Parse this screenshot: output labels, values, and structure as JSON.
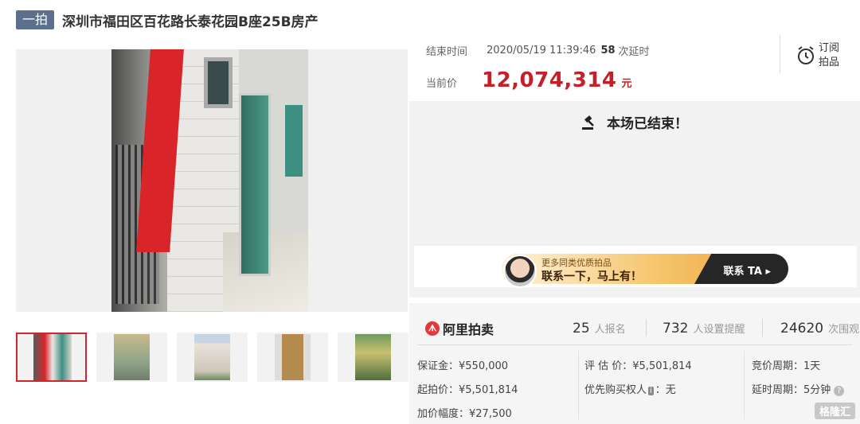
{
  "header": {
    "badge": "一拍",
    "title": "深圳市福田区百花路长泰花园B座25B房产"
  },
  "auction": {
    "end_label": "结束时间",
    "end_time": "2020/05/19 11:39:46",
    "delay_count": "58",
    "delay_label": "次延时",
    "price_label": "当前价",
    "price": "12,074,314",
    "price_unit": "元"
  },
  "subscribe": {
    "line1": "订阅",
    "line2": "拍品",
    "icon": "alarm-clock-icon"
  },
  "ended": {
    "message": "本场已结束！",
    "icon": "gavel-icon"
  },
  "contact": {
    "line1": "更多同类优质拍品",
    "line2": "联系一下，马上有！",
    "button": "联系 TA"
  },
  "stats": {
    "brand": "阿里拍卖",
    "signups": "25",
    "signups_label": "人报名",
    "reminders": "732",
    "reminders_label": "人设置提醒",
    "views": "24620",
    "views_label": "次围观"
  },
  "details": {
    "deposit": "保证金：¥550,000",
    "start_price": "起拍价：¥5,501,814",
    "increment": "加价幅度：¥27,500",
    "appraisal": "评 估 价：¥5,501,814",
    "priority_label": "优先购买权人",
    "priority_tag": "i",
    "priority_value": "：无",
    "bid_cycle": "竞价周期：1天",
    "delay_cycle": "延时周期：5分钟"
  },
  "thumbnails": [
    {
      "name": "thumb-1",
      "active": true
    },
    {
      "name": "thumb-2",
      "active": false
    },
    {
      "name": "thumb-3",
      "active": false
    },
    {
      "name": "thumb-4",
      "active": false
    },
    {
      "name": "thumb-5",
      "active": false
    }
  ],
  "watermark": "格隆汇",
  "colors": {
    "accent": "#c4202a",
    "badge": "#5c6f8c",
    "active_border": "#d0262c"
  }
}
